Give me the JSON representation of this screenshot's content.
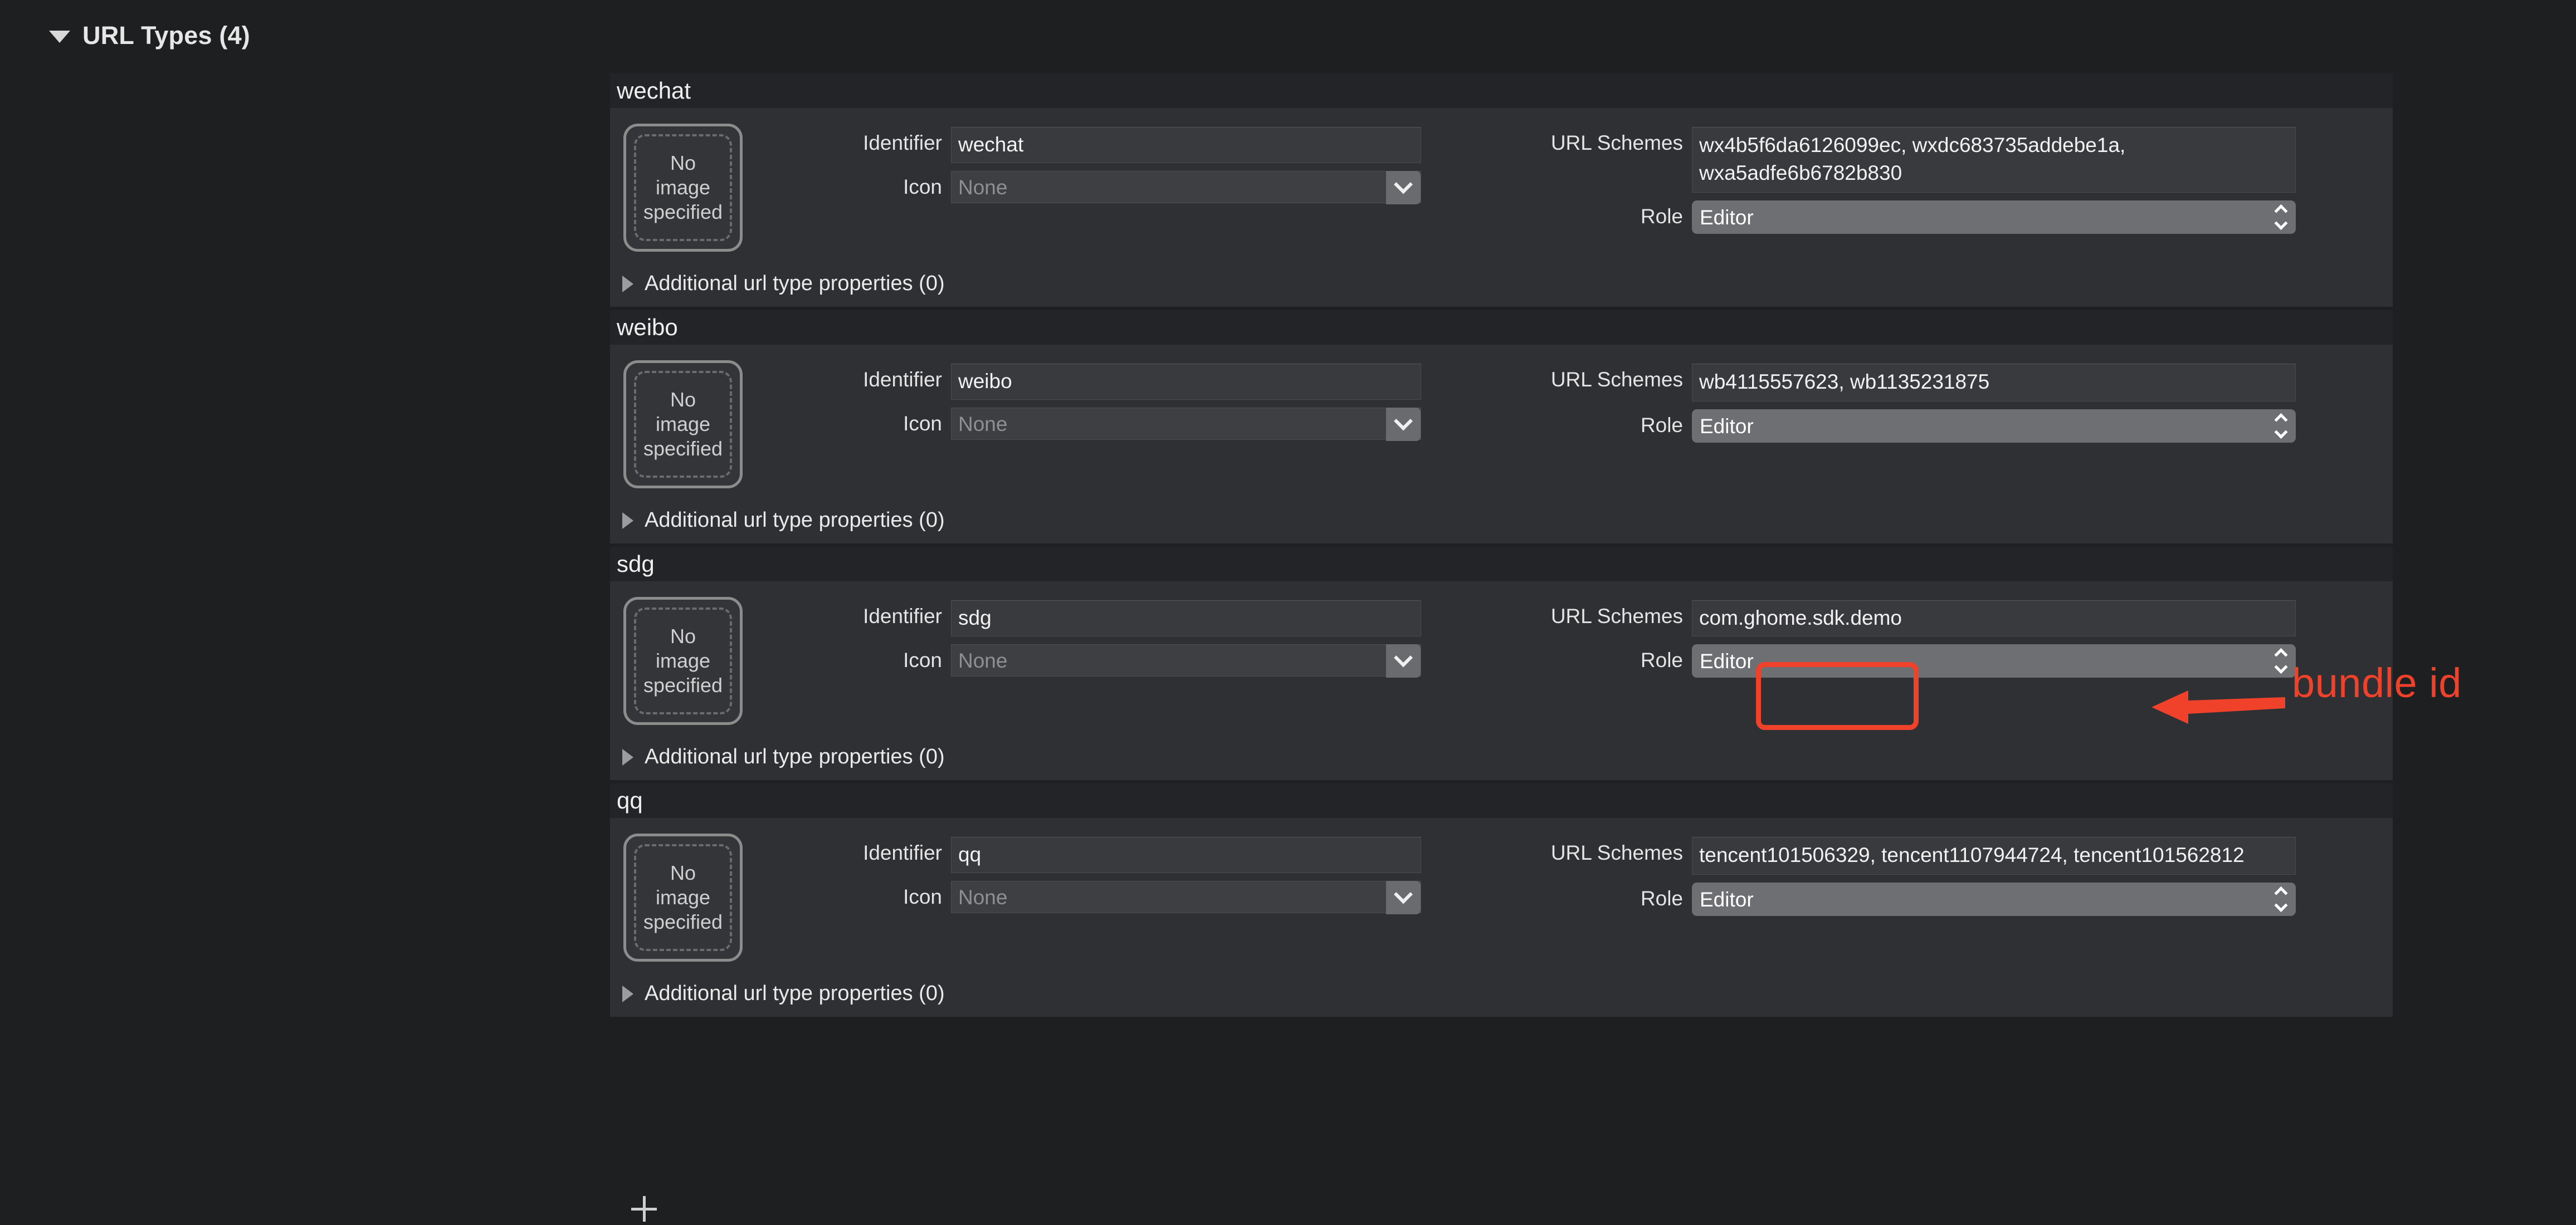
{
  "section": {
    "title": "URL Types (4)",
    "disclosure_icon": "triangle-down-icon"
  },
  "labels": {
    "identifier": "Identifier",
    "icon": "Icon",
    "url_schemes": "URL Schemes",
    "role": "Role",
    "additional_properties": "Additional url type properties (0)",
    "no_image": [
      "No",
      "image",
      "specified"
    ]
  },
  "placeholders": {
    "icon": "None"
  },
  "url_types": [
    {
      "name": "wechat",
      "identifier": "wechat",
      "icon": "None",
      "url_schemes": "wx4b5f6da6126099ec, wxdc683735addebe1a, wxa5adfe6b6782b830",
      "role": "Editor",
      "additional_properties": "Additional url type properties (0)"
    },
    {
      "name": "weibo",
      "identifier": "weibo",
      "icon": "None",
      "url_schemes": "wb4115557623, wb1135231875",
      "role": "Editor",
      "additional_properties": "Additional url type properties (0)"
    },
    {
      "name": "sdg",
      "identifier": "sdg",
      "icon": "None",
      "url_schemes": "com.ghome.sdk.demo",
      "role": "Editor",
      "additional_properties": "Additional url type properties (0)"
    },
    {
      "name": "qq",
      "identifier": "qq",
      "icon": "None",
      "url_schemes": "tencent101506329, tencent1107944724, tencent101562812",
      "role": "Editor",
      "additional_properties": "Additional url type properties (0)"
    }
  ],
  "footer": {
    "add_button": "+"
  },
  "annotation": {
    "text": "bundle id",
    "color": "#f0422a",
    "highlight_target": "com.ghome.sdk.demo",
    "arrow_direction": "left"
  },
  "colors": {
    "page_background": "#1e1f21",
    "group_header_background": "#232427",
    "group_body_background": "#2f3033",
    "text_primary": "#f0f0f0",
    "text_placeholder": "#8e8f93",
    "annotation_red": "#f0422a"
  }
}
